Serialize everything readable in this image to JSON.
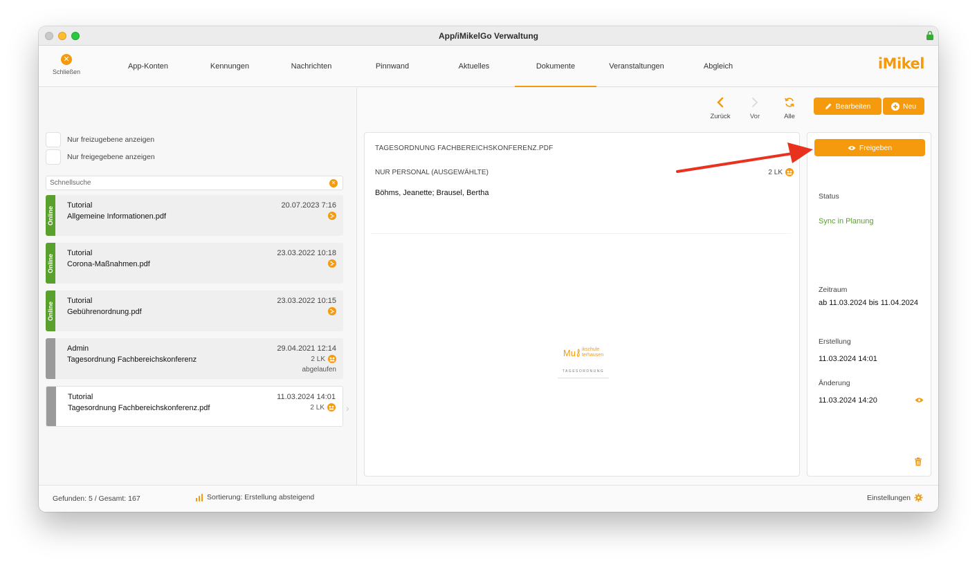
{
  "window": {
    "title": "App/iMikelGo Verwaltung"
  },
  "toolbar": {
    "close_label": "Schließen",
    "tabs": [
      "App-Konten",
      "Kennungen",
      "Nachrichten",
      "Pinnwand",
      "Aktuelles",
      "Dokumente",
      "Veranstaltungen",
      "Abgleich"
    ],
    "active_tab": "Dokumente",
    "logo": "iMikel"
  },
  "filters": {
    "unreleased": "Nur freizugebene anzeigen",
    "released": "Nur freigegebene anzeigen"
  },
  "search": {
    "placeholder": "Schnellsuche"
  },
  "documents": [
    {
      "status": "Online",
      "owner": "Tutorial",
      "name": "Allgemeine Informationen.pdf",
      "date": "20.07.2023 7:16",
      "audience": "",
      "extra": ""
    },
    {
      "status": "Online",
      "owner": "Tutorial",
      "name": "Corona-Maßnahmen.pdf",
      "date": "23.03.2022 10:18",
      "audience": "",
      "extra": ""
    },
    {
      "status": "Online",
      "owner": "Tutorial",
      "name": "Gebührenordnung.pdf",
      "date": "23.03.2022 10:15",
      "audience": "",
      "extra": ""
    },
    {
      "status": "",
      "owner": "Admin",
      "name": "Tagesordnung Fachbereichskonferenz",
      "date": "29.04.2021 12:14",
      "audience": "2 LK",
      "extra": "abgelaufen"
    },
    {
      "status": "",
      "owner": "Tutorial",
      "name": "Tagesordnung Fachbereichskonferenz.pdf",
      "date": "11.03.2024 14:01",
      "audience": "2 LK",
      "extra": ""
    }
  ],
  "nav": {
    "back": "Zurück",
    "forward": "Vor",
    "all": "Alle"
  },
  "actions": {
    "edit": "Bearbeiten",
    "new": "Neu",
    "release": "Freigeben"
  },
  "detail": {
    "title": "TAGESORDNUNG FACHBEREICHSKONFERENZ.PDF",
    "audience": "NUR PERSONAL (AUSGEWÄHLTE)",
    "audience_count": "2 LK",
    "recipients": "Böhms, Jeanette; Brausel, Bertha",
    "preview": {
      "brand_main": "Mu",
      "brand_line1": "ikschule",
      "brand_line2": "terhausen",
      "heading": "TAGESORDNUNG"
    }
  },
  "side": {
    "status_label": "Status",
    "status_value": "Sync in Planung",
    "period_label": "Zeitraum",
    "period_value": "ab 11.03.2024 bis 11.04.2024",
    "created_label": "Erstellung",
    "created_value": "11.03.2024 14:01",
    "changed_label": "Änderung",
    "changed_value": "11.03.2024 14:20"
  },
  "statusbar": {
    "found": "Gefunden: 5 / Gesamt: 167",
    "sort": "Sortierung: Erstellung absteigend",
    "settings": "Einstellungen"
  },
  "colors": {
    "accent": "#f59a0c",
    "online": "#5aa02c",
    "inactive": "#9a9a9a",
    "annotation_arrow": "#e8321e"
  }
}
